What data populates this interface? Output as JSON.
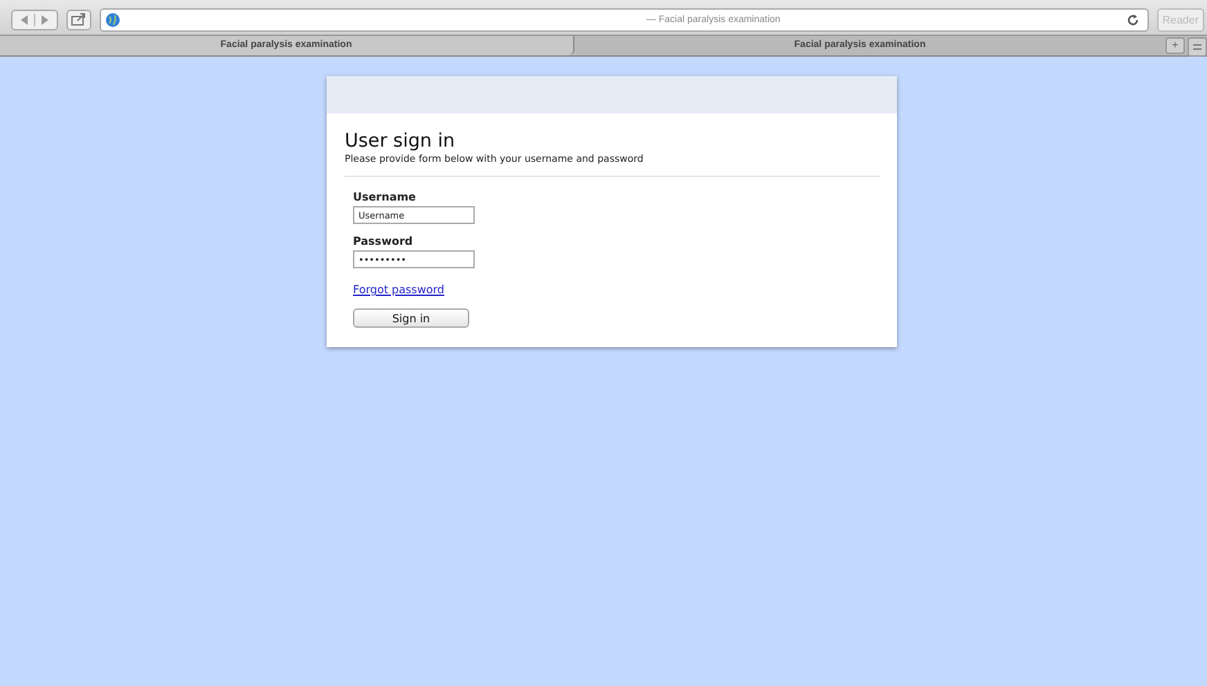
{
  "browser": {
    "address_title": "— Facial paralysis examination",
    "reader": "Reader",
    "new_tab": "+",
    "tabs": [
      {
        "label": "Facial paralysis examination",
        "selected": true
      },
      {
        "label": "Facial paralysis examination",
        "selected": false
      }
    ]
  },
  "form": {
    "title": "User sign in",
    "subtitle": "Please provide form below with your username and password",
    "fields": [
      {
        "label": "Username",
        "value": "Username"
      },
      {
        "label": "Password",
        "value": "•••••••••"
      }
    ],
    "forgot_link": "Forgot password",
    "submit": "Sign in"
  }
}
